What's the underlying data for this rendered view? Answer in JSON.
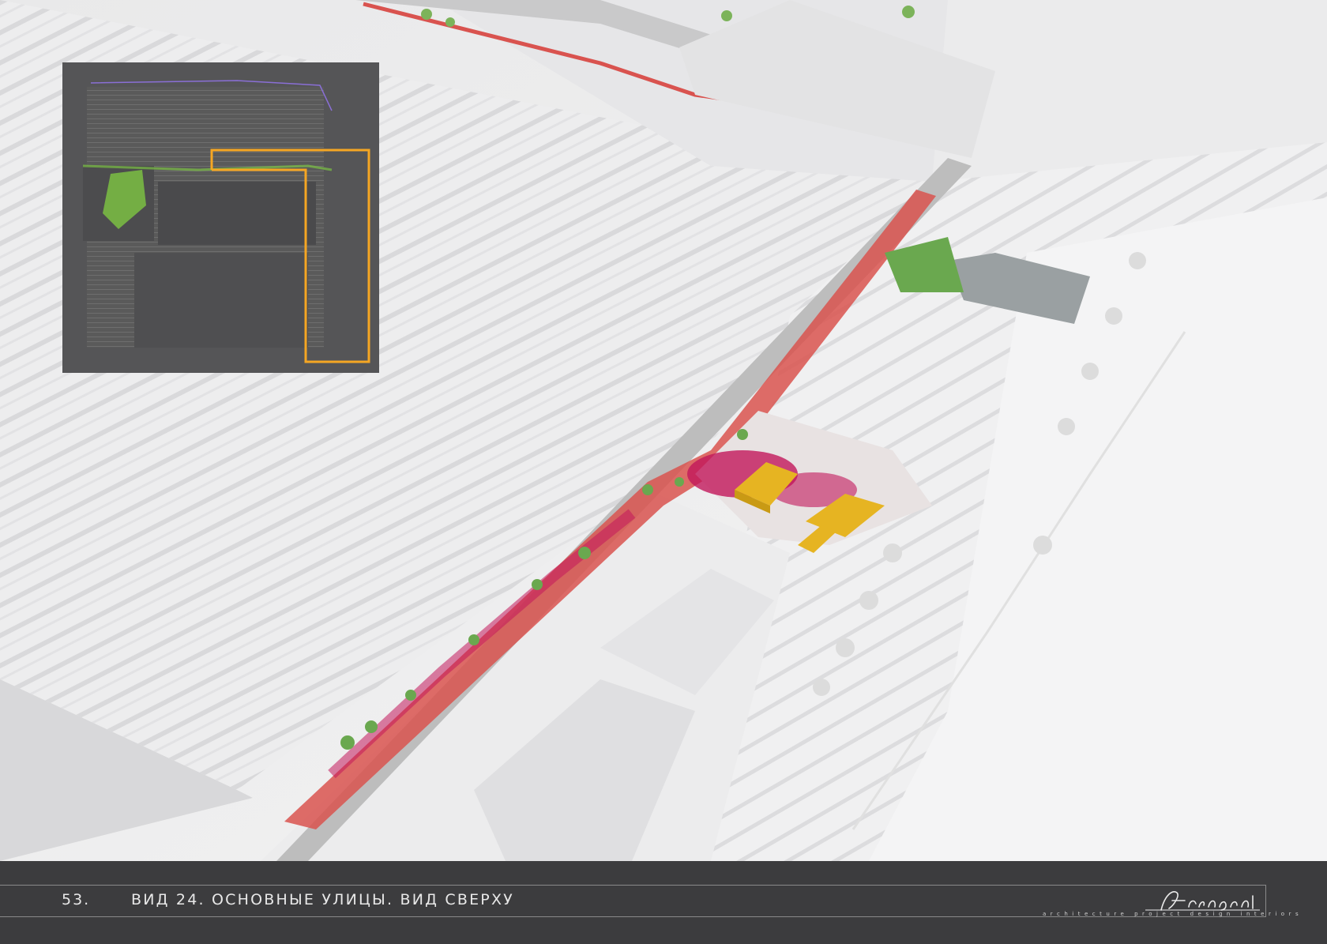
{
  "footer": {
    "page_number": "53.",
    "caption": "ВИД 24. ОСНОВНЫЕ УЛИЦЫ. ВИД СВЕРХУ",
    "logo_text": "Archigraph",
    "logo_tagline": "architecture project design interiors"
  },
  "colors": {
    "footer_bg": "#3c3c3e",
    "highlight_frame": "#f5a623",
    "pedestrian_path": "#d9534f",
    "plaza_paving": "#c2185b",
    "pavilion": "#e6b422",
    "greenery": "#6aa84f"
  }
}
